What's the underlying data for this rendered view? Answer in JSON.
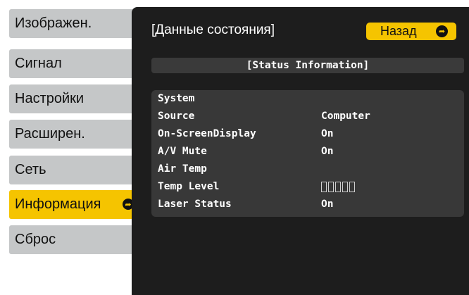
{
  "menu": {
    "items": [
      {
        "label": "Изображен.",
        "active": false
      },
      {
        "label": "Сигнал",
        "active": false
      },
      {
        "label": "Настройки",
        "active": false
      },
      {
        "label": "Расширен.",
        "active": false
      },
      {
        "label": "Сеть",
        "active": false
      },
      {
        "label": "Информация",
        "active": true
      },
      {
        "label": "Сброс",
        "active": false
      }
    ]
  },
  "panel": {
    "title": "[Данные состояния]",
    "back_label": "Назад",
    "section_header": "[Status Information]",
    "rows": [
      {
        "label": "System",
        "value": ""
      },
      {
        "label": "Source",
        "value": "Computer"
      },
      {
        "label": "On-ScreenDisplay",
        "value": "On"
      },
      {
        "label": "A/V Mute",
        "value": "On"
      },
      {
        "label": "Air Temp",
        "value": ""
      },
      {
        "label": "Temp Level",
        "value": "",
        "level_boxes": 5
      },
      {
        "label": "Laser Status",
        "value": "On"
      }
    ]
  },
  "colors": {
    "accent": "#f5c400",
    "menu_bg": "#c5c7c8",
    "panel_bg": "#1d1d1d",
    "info_bg": "#383838"
  },
  "icons": {
    "enter": "enter-arrow-icon"
  }
}
